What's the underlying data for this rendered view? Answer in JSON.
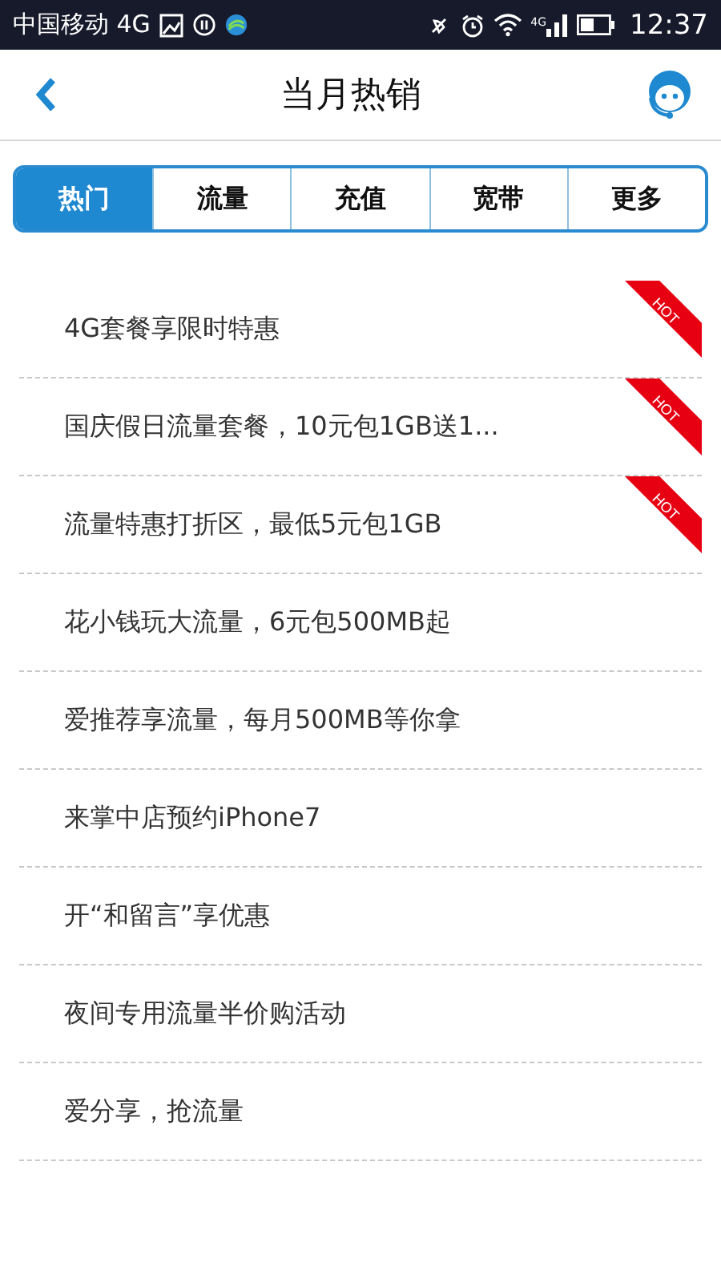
{
  "status_bar": {
    "carrier": "中国移动 4G",
    "network": "4G",
    "time": "12:37"
  },
  "header": {
    "title": "当月热销"
  },
  "tabs": [
    {
      "label": "热门",
      "selected": true
    },
    {
      "label": "流量",
      "selected": false
    },
    {
      "label": "充值",
      "selected": false
    },
    {
      "label": "宽带",
      "selected": false
    },
    {
      "label": "更多",
      "selected": false
    }
  ],
  "items": [
    {
      "text": "4G套餐享限时特惠",
      "hot": true,
      "badge": "HOT"
    },
    {
      "text": "国庆假日流量套餐，10元包1GB送1...",
      "hot": true,
      "badge": "HOT"
    },
    {
      "text": "流量特惠打折区，最低5元包1GB",
      "hot": true,
      "badge": "HOT"
    },
    {
      "text": "花小钱玩大流量，6元包500MB起",
      "hot": false
    },
    {
      "text": "爱推荐享流量，每月500MB等你拿",
      "hot": false
    },
    {
      "text": "来掌中店预约iPhone7",
      "hot": false
    },
    {
      "text": "开“和留言”享优惠",
      "hot": false
    },
    {
      "text": "夜间专用流量半价购活动",
      "hot": false
    },
    {
      "text": "爱分享，抢流量",
      "hot": false
    }
  ]
}
